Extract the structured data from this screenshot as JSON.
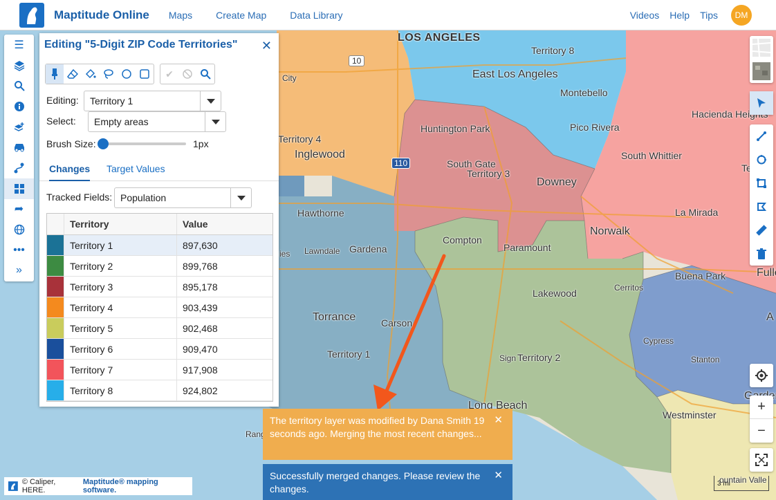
{
  "header": {
    "brand": "Maptitude Online",
    "nav": [
      "Maps",
      "Create Map",
      "Data Library"
    ],
    "nav_right": [
      "Videos",
      "Help",
      "Tips"
    ],
    "avatar": "DM"
  },
  "panel": {
    "title": "Editing \"5-Digit ZIP Code Territories\"",
    "close": "✕",
    "editing_label": "Editing:",
    "editing_value": "Territory 1",
    "select_label": "Select:",
    "select_value": "Empty areas",
    "brush_label": "Brush Size:",
    "brush_value": "1px",
    "tabs": [
      "Changes",
      "Target Values"
    ],
    "tracked_label": "Tracked Fields:",
    "tracked_value": "Population",
    "table": {
      "headers": [
        "Territory",
        "Value"
      ],
      "rows": [
        {
          "name": "Territory 1",
          "value": "897,630",
          "color": "#1b7296"
        },
        {
          "name": "Territory 2",
          "value": "899,768",
          "color": "#3d8b42"
        },
        {
          "name": "Territory 3",
          "value": "895,178",
          "color": "#a8323a"
        },
        {
          "name": "Territory 4",
          "value": "903,439",
          "color": "#f48a1e"
        },
        {
          "name": "Territory 5",
          "value": "902,468",
          "color": "#c9cc5c"
        },
        {
          "name": "Territory 6",
          "value": "909,470",
          "color": "#1a4f9c"
        },
        {
          "name": "Territory 7",
          "value": "917,908",
          "color": "#f2545b"
        },
        {
          "name": "Territory 8",
          "value": "924,802",
          "color": "#27aee9"
        }
      ]
    }
  },
  "map_labels": {
    "los_angeles": "LOS ANGELES",
    "territory8": "Territory 8",
    "east_la": "East Los Angeles",
    "montebello": "Montebello",
    "city": "City",
    "pico": "Pico Rivera",
    "hacienda": "Hacienda Heights",
    "huntington": "Huntington Park",
    "territory4": "Territory 4",
    "inglewood": "Inglewood",
    "south_gate": "South Gate",
    "territory3": "Territory 3",
    "downey": "Downey",
    "whittier": "South Whittier",
    "territory7": "Territ",
    "la_mirada": "La Mirada",
    "hawthorne": "Hawthorne",
    "compton": "Compton",
    "gardena": "Gardena",
    "lawndale": "Lawndale",
    "paramount": "Paramount",
    "norwalk": "Norwalk",
    "cerritos": "Cerritos",
    "buena_park": "Buena Park",
    "fullerton": "Fulle",
    "lakewood": "Lakewood",
    "torrance": "Torrance",
    "carson": "Carson",
    "cypress": "Cypress",
    "territory1": "Territory 1",
    "signal": "Sign",
    "territory2": "Territory 2",
    "stanton": "Stanton",
    "garden": "Garden",
    "long_beach": "Long Beach",
    "westminster": "Westminster",
    "rancho": "Rang",
    "fountain": "ountain Valle",
    "ana": "A",
    "ies": "ies",
    "hwy10": "10",
    "hwy110": "110"
  },
  "toasts": [
    {
      "text": "The territory layer was modified by Dana Smith 19 seconds ago. Merging the most recent changes...",
      "color": "#f0ad4e"
    },
    {
      "text": "Successfully merged changes. Please review the changes.",
      "color": "#2d72b5"
    }
  ],
  "toast_close": "✕",
  "attribution": {
    "prefix": "© Caliper, HERE.",
    "link": "Maptitude® mapping software."
  },
  "scale": "3 mi",
  "colors": {
    "accent": "#1a6fc4",
    "brand": "#1a5fa8",
    "arrow": "#f2571c"
  }
}
